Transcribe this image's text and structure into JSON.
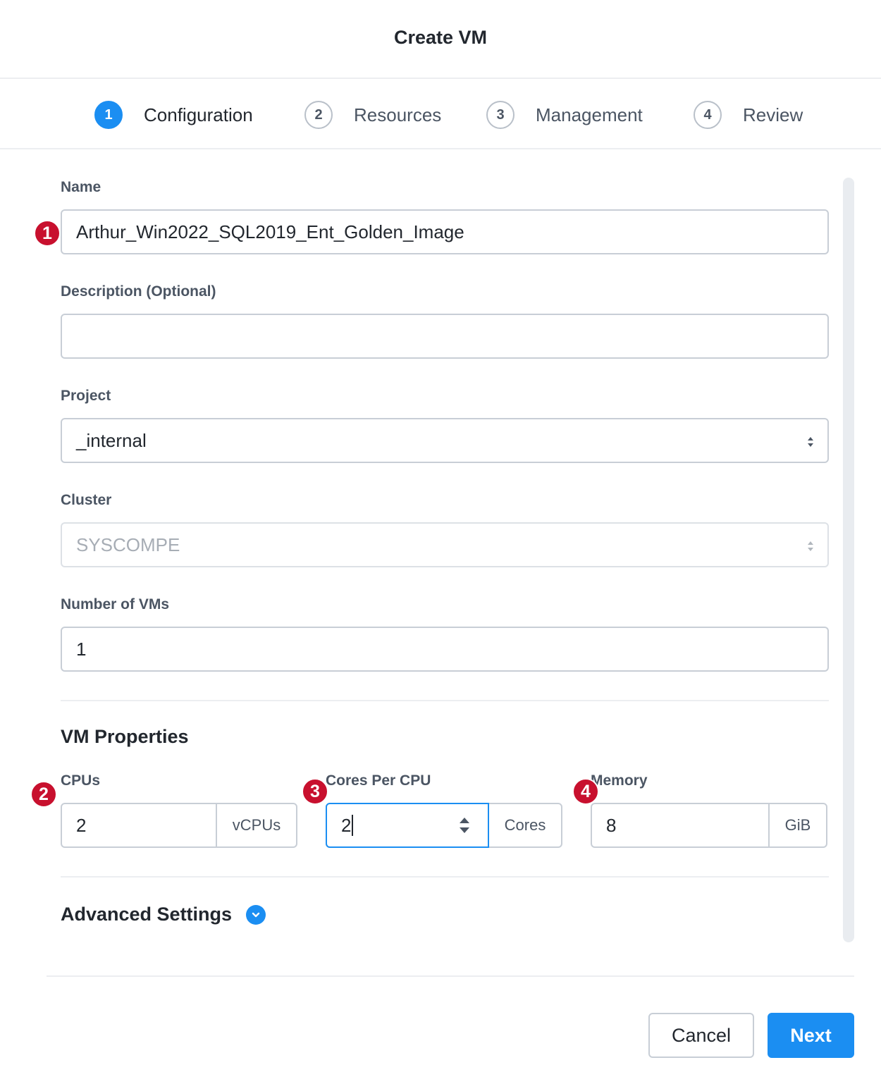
{
  "dialog": {
    "title": "Create VM"
  },
  "steps": [
    {
      "num": "1",
      "label": "Configuration",
      "active": true
    },
    {
      "num": "2",
      "label": "Resources"
    },
    {
      "num": "3",
      "label": "Management"
    },
    {
      "num": "4",
      "label": "Review"
    }
  ],
  "form": {
    "name": {
      "label": "Name",
      "value": "Arthur_Win2022_SQL2019_Ent_Golden_Image"
    },
    "description": {
      "label": "Description (Optional)",
      "value": ""
    },
    "project": {
      "label": "Project",
      "value": "_internal"
    },
    "cluster": {
      "label": "Cluster",
      "value": "SYSCOMPE"
    },
    "num_vms": {
      "label": "Number of VMs",
      "value": "1"
    }
  },
  "vm_properties": {
    "title": "VM Properties",
    "cpus": {
      "label": "CPUs",
      "value": "2",
      "unit": "vCPUs"
    },
    "cores": {
      "label": "Cores Per CPU",
      "value": "2",
      "unit": "Cores"
    },
    "memory": {
      "label": "Memory",
      "value": "8",
      "unit": "GiB"
    }
  },
  "advanced": {
    "label": "Advanced Settings"
  },
  "badges": [
    "1",
    "2",
    "3",
    "4"
  ],
  "buttons": {
    "cancel": "Cancel",
    "next": "Next"
  },
  "colors": {
    "accent": "#1b8ef2",
    "badge": "#c8102e"
  }
}
